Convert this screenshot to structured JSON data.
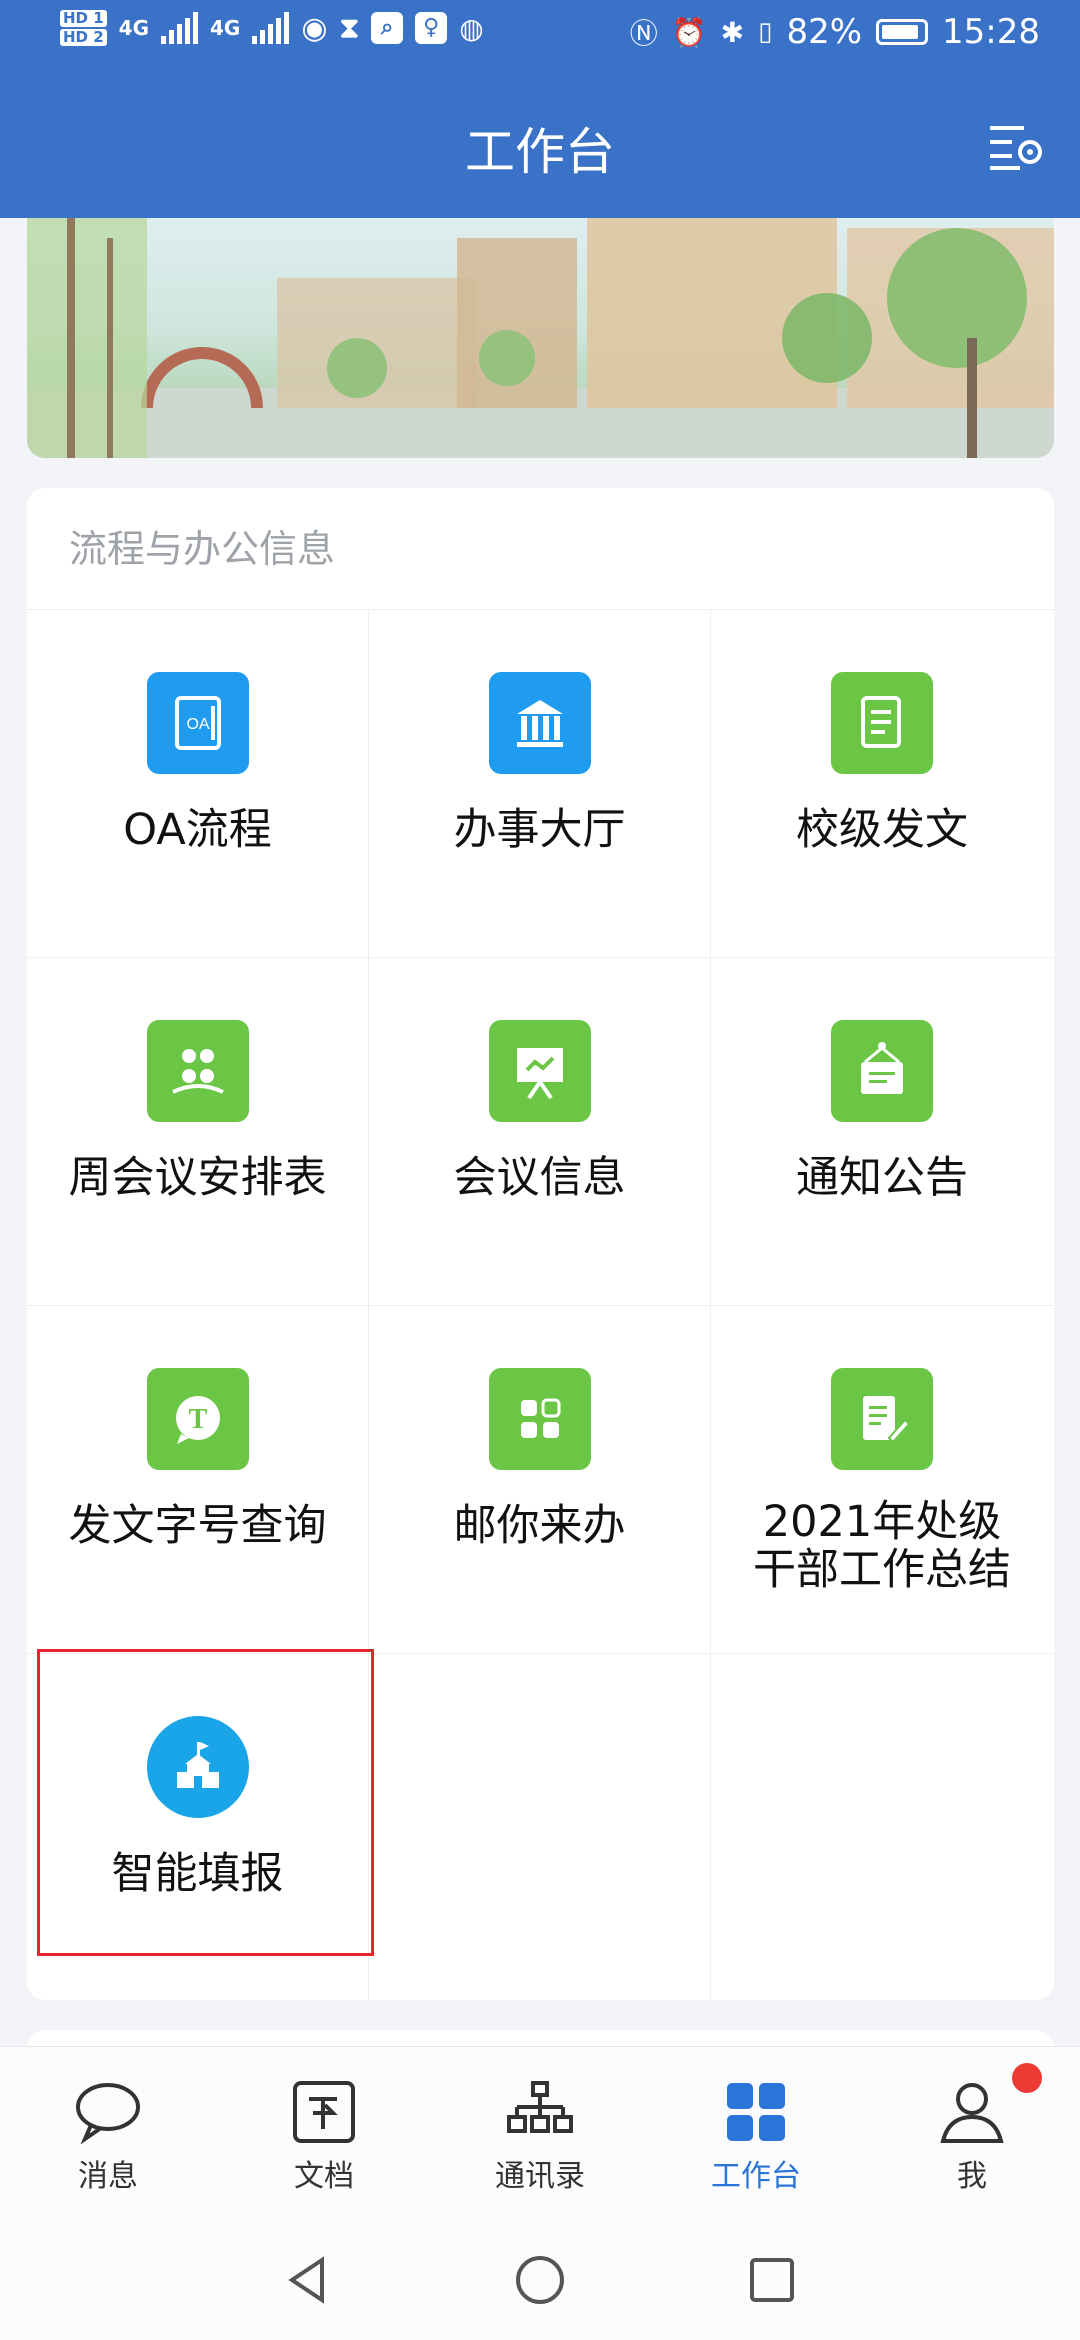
{
  "status_bar": {
    "sim1": "HD 1",
    "sim2": "HD 2",
    "network1": "4G",
    "network2": "4G",
    "battery_percent": "82%",
    "time": "15:28"
  },
  "app_bar": {
    "title": "工作台",
    "menu_icon": "list-settings-icon"
  },
  "section": {
    "title": "流程与办公信息",
    "items": [
      {
        "label": "OA流程",
        "icon": "oa-doc-icon",
        "color": "#1f9cf0"
      },
      {
        "label": "办事大厅",
        "icon": "government-building-icon",
        "color": "#1f9cf0"
      },
      {
        "label": "校级发文",
        "icon": "scroll-document-icon",
        "color": "#6cc645"
      },
      {
        "label": "周会议安排表",
        "icon": "people-meeting-icon",
        "color": "#6cc645"
      },
      {
        "label": "会议信息",
        "icon": "presentation-board-icon",
        "color": "#6cc645"
      },
      {
        "label": "通知公告",
        "icon": "notice-board-icon",
        "color": "#6cc645"
      },
      {
        "label": "发文字号查询",
        "icon": "text-bubble-icon",
        "color": "#6cc645"
      },
      {
        "label": "邮你来办",
        "icon": "apps-grid-icon",
        "color": "#6cc645"
      },
      {
        "label": "2021年处级\n干部工作总结",
        "icon": "edit-document-icon",
        "color": "#6cc645"
      },
      {
        "label": "智能填报",
        "icon": "school-building-icon",
        "color": "#1aa5e8"
      }
    ]
  },
  "tabs": [
    {
      "label": "消息",
      "icon": "chat-bubble-icon",
      "active": false
    },
    {
      "label": "文档",
      "icon": "document-box-icon",
      "active": false
    },
    {
      "label": "通讯录",
      "icon": "org-chart-icon",
      "active": false
    },
    {
      "label": "工作台",
      "icon": "grid-icon",
      "active": true
    },
    {
      "label": "我",
      "icon": "person-icon",
      "active": false
    }
  ],
  "colors": {
    "primary": "#3a72c8",
    "active_tab": "#2b74d8",
    "badge": "#ee3a34",
    "highlight": "#e5262a"
  }
}
